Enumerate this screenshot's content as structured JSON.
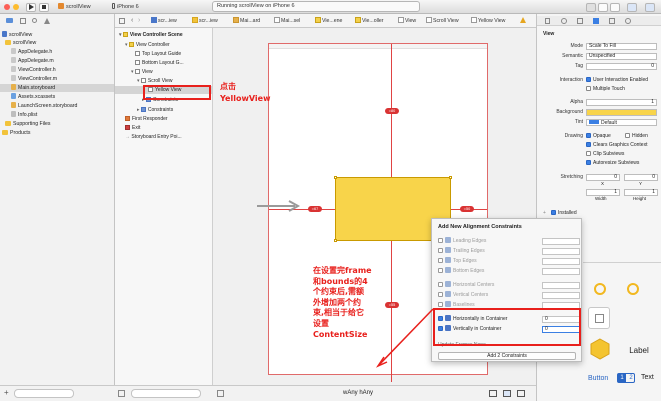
{
  "toolbar": {
    "scheme": "scrollView",
    "device": "iPhone 6",
    "activity": "Running scrollView on iPhone 6"
  },
  "jumpbar": {
    "crumbs": [
      "scr...iew",
      "scr...iew",
      "Mai...ard",
      "Mai...sel",
      "Vie...ene",
      "Vie...oller",
      "View",
      "Scroll View",
      "Yellow View"
    ]
  },
  "navigator": {
    "project": "scrollView",
    "files": [
      {
        "name": "scrollView",
        "type": "folder"
      },
      {
        "name": "AppDelegate.h",
        "type": "h"
      },
      {
        "name": "AppDelegate.m",
        "type": "m"
      },
      {
        "name": "ViewController.h",
        "type": "h"
      },
      {
        "name": "ViewController.m",
        "type": "m"
      },
      {
        "name": "Main.storyboard",
        "type": "storyboard"
      },
      {
        "name": "Assets.xcassets",
        "type": "assets"
      },
      {
        "name": "LaunchScreen.storyboard",
        "type": "storyboard"
      },
      {
        "name": "Info.plist",
        "type": "plist"
      },
      {
        "name": "Supporting Files",
        "type": "folder"
      },
      {
        "name": "Products",
        "type": "folder"
      }
    ]
  },
  "outline": {
    "items": [
      {
        "label": "View Controller Scene"
      },
      {
        "label": "View Controller"
      },
      {
        "label": "Top Layout Guide"
      },
      {
        "label": "Bottom Layout G..."
      },
      {
        "label": "View"
      },
      {
        "label": "Scroll View"
      },
      {
        "label": "Yellow View"
      },
      {
        "label": "Constraints"
      },
      {
        "label": "Constraints"
      },
      {
        "label": "First Responder"
      },
      {
        "label": "Exit"
      },
      {
        "label": "Storyboard Entry Poi..."
      }
    ]
  },
  "canvas": {
    "size_class": "wAny hAny",
    "constraint_badges": [
      "=80",
      "=67",
      "=50",
      "=55"
    ]
  },
  "annotations": {
    "click_label": "点击",
    "click_target": "YellowView",
    "note_lines": [
      "在设置完frame",
      "和bounds的4",
      "个约束后,需额",
      "外增加两个约",
      "束,相当于给它",
      "设置",
      "ContentSize"
    ]
  },
  "popover": {
    "title": "Add New Alignment Constraints",
    "rows": [
      {
        "label": "Leading Edges",
        "enabled": false,
        "checked": false,
        "value": ""
      },
      {
        "label": "Trailing Edges",
        "enabled": false,
        "checked": false,
        "value": ""
      },
      {
        "label": "Top Edges",
        "enabled": false,
        "checked": false,
        "value": ""
      },
      {
        "label": "Bottom Edges",
        "enabled": false,
        "checked": false,
        "value": ""
      },
      {
        "label": "Horizontal Centers",
        "enabled": false,
        "checked": false,
        "value": ""
      },
      {
        "label": "Vertical Centers",
        "enabled": false,
        "checked": false,
        "value": ""
      },
      {
        "label": "Baselines",
        "enabled": false,
        "checked": false,
        "value": ""
      },
      {
        "label": "Horizontally in Container",
        "enabled": true,
        "checked": true,
        "value": "0"
      },
      {
        "label": "Vertically in Container",
        "enabled": true,
        "checked": true,
        "value": "0"
      }
    ],
    "update_frames_label": "Update Frames",
    "update_frames_value": "None",
    "add_button": "Add 2 Constraints"
  },
  "inspector": {
    "section": "View",
    "mode_label": "Mode",
    "mode_value": "Scale To Fill",
    "semantic_label": "Semantic",
    "semantic_value": "Unspecified",
    "tag_label": "Tag",
    "tag_value": "0",
    "interaction_label": "Interaction",
    "user_interaction": "User Interaction Enabled",
    "multiple_touch": "Multiple Touch",
    "alpha_label": "Alpha",
    "alpha_value": "1",
    "background_label": "Background",
    "tint_label": "Tint",
    "tint_value": "Default",
    "drawing_label": "Drawing",
    "opaque": "Opaque",
    "hidden": "Hidden",
    "clears": "Clears Graphics Context",
    "clip": "Clip Subviews",
    "autoresize": "Autoresize Subviews",
    "stretching_label": "Stretching",
    "stretch_x": "0",
    "stretch_y": "0",
    "stretch_w": "1",
    "stretch_h": "1",
    "x_label": "X",
    "y_label": "Y",
    "width_label": "Width",
    "height_label": "Height",
    "installed": "Installed",
    "background_color": "#f8d44a"
  },
  "library": {
    "items": [
      {
        "label": "Label"
      },
      {
        "label": "Button"
      },
      {
        "label": "Text"
      }
    ],
    "segment_1": "1",
    "segment_2": "2"
  },
  "colors": {
    "yellow": "#f8d44a",
    "annotation_red": "#e8201c",
    "constraint_red": "#e04343"
  }
}
